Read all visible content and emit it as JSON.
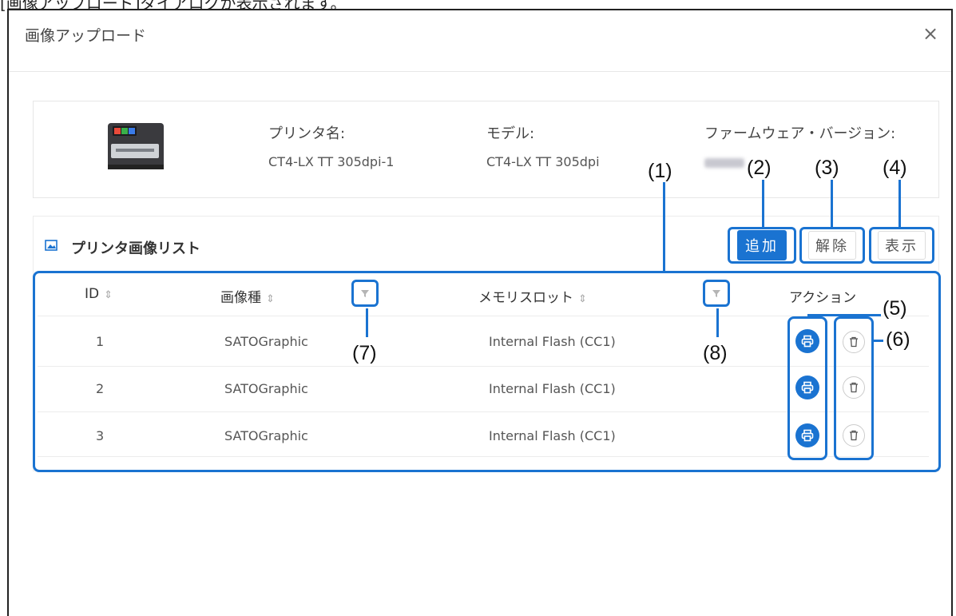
{
  "caption": "[画像アップロード]ダイアログが表示されます。",
  "dialog": {
    "title": "画像アップロード",
    "close_icon": "close-icon",
    "close_glyph": "×"
  },
  "printer": {
    "name_label": "プリンタ名:",
    "name_value": "CT4-LX TT 305dpi-1",
    "model_label": "モデル:",
    "model_value": "CT4-LX TT 305dpi",
    "firmware_label": "ファームウェア・バージョン:"
  },
  "image_list": {
    "title": "プリンタ画像リスト",
    "icon": "image-icon",
    "buttons": {
      "add": "追加",
      "release": "解除",
      "show": "表示"
    },
    "columns": {
      "id": "ID",
      "image_type": "画像種",
      "memory_slot": "メモリスロット",
      "action": "アクション"
    },
    "sort_glyph": "⇕",
    "rows": [
      {
        "id": "1",
        "image_type": "SATOGraphic",
        "memory_slot": "Internal Flash (CC1)"
      },
      {
        "id": "2",
        "image_type": "SATOGraphic",
        "memory_slot": "Internal Flash (CC1)"
      },
      {
        "id": "3",
        "image_type": "SATOGraphic",
        "memory_slot": "Internal Flash (CC1)"
      }
    ]
  },
  "callouts": {
    "c1": "(1)",
    "c2": "(2)",
    "c3": "(3)",
    "c4": "(4)",
    "c5": "(5)",
    "c6": "(6)",
    "c7": "(7)",
    "c8": "(8)"
  },
  "colors": {
    "accent": "#1a73d1",
    "border": "#e6e6e6",
    "text": "#333333"
  }
}
